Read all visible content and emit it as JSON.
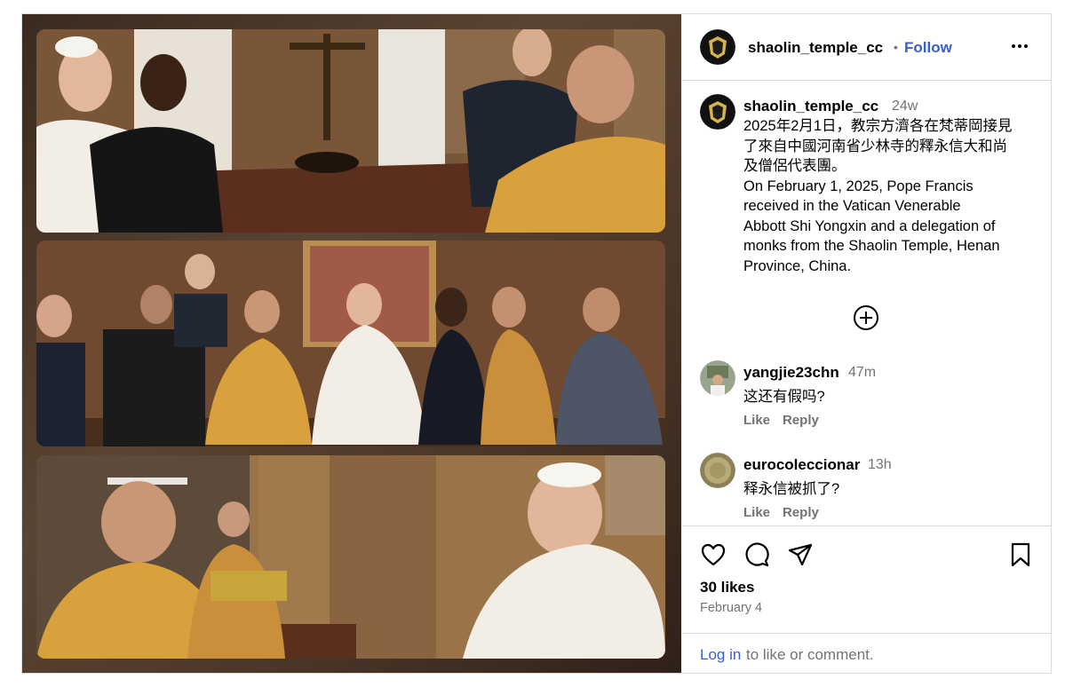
{
  "post": {
    "photos": [
      {
        "name": "photo-pope-meeting"
      },
      {
        "name": "photo-group-portrait"
      },
      {
        "name": "photo-gift-exchange"
      }
    ]
  },
  "header": {
    "username": "shaolin_temple_cc",
    "separator": "•",
    "follow_label": "Follow",
    "more_icon": "more-horizontal-icon"
  },
  "caption": {
    "username": "shaolin_temple_cc",
    "time": "24w",
    "text": "2025年2月1日，教宗方濟各在梵蒂岡接見\n了來自中國河南省少林寺的釋永信大和尚\n及僧侶代表團。\nOn February 1, 2025, Pope Francis\nreceived in the Vatican Venerable\nAbbott Shi Yongxin and a delegation of\nmonks from the Shaolin Temple, Henan\nProvince, China."
  },
  "comments": [
    {
      "username": "yangjie23chn",
      "time": "47m",
      "text": "这还有假吗?",
      "like_label": "Like",
      "reply_label": "Reply"
    },
    {
      "username": "eurocoleccionar",
      "time": "13h",
      "text": "释永信被抓了?",
      "like_label": "Like",
      "reply_label": "Reply"
    }
  ],
  "actions": {
    "icons": [
      "heart-icon",
      "comment-icon",
      "share-icon",
      "bookmark-icon"
    ],
    "likes": "30 likes",
    "date": "February 4",
    "login_link": "Log in",
    "login_rest": "to like or comment."
  },
  "colors": {
    "link_blue": "#3a5dd0",
    "secondary_text": "#737373",
    "border": "#dbdbdb",
    "robe_saffron": "#d9a13e",
    "papal_white": "#f2eee6"
  }
}
